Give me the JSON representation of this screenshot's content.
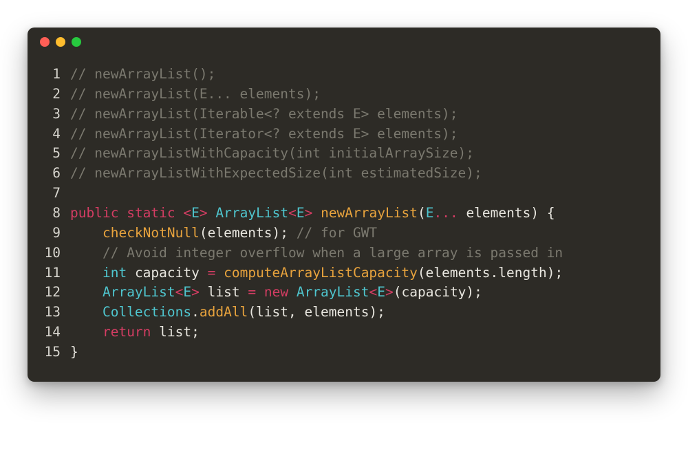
{
  "window": {
    "traffic_lights": {
      "close": "#ff5f56",
      "minimize": "#ffbd2e",
      "maximize": "#27c93f"
    }
  },
  "code": {
    "lines": [
      {
        "num": "1",
        "tokens": [
          {
            "cls": "tok-comment",
            "t": "// newArrayList();"
          }
        ]
      },
      {
        "num": "2",
        "tokens": [
          {
            "cls": "tok-comment",
            "t": "// newArrayList(E... elements);"
          }
        ]
      },
      {
        "num": "3",
        "tokens": [
          {
            "cls": "tok-comment",
            "t": "// newArrayList(Iterable<? extends E> elements);"
          }
        ]
      },
      {
        "num": "4",
        "tokens": [
          {
            "cls": "tok-comment",
            "t": "// newArrayList(Iterator<? extends E> elements);"
          }
        ]
      },
      {
        "num": "5",
        "tokens": [
          {
            "cls": "tok-comment",
            "t": "// newArrayListWithCapacity(int initialArraySize);"
          }
        ]
      },
      {
        "num": "6",
        "tokens": [
          {
            "cls": "tok-comment",
            "t": "// newArrayListWithExpectedSize(int estimatedSize);"
          }
        ]
      },
      {
        "num": "7",
        "tokens": [
          {
            "cls": "tok-ident",
            "t": ""
          }
        ]
      },
      {
        "num": "8",
        "tokens": [
          {
            "cls": "tok-keyword",
            "t": "public"
          },
          {
            "cls": "tok-ident",
            "t": " "
          },
          {
            "cls": "tok-keyword",
            "t": "static"
          },
          {
            "cls": "tok-ident",
            "t": " "
          },
          {
            "cls": "tok-generic",
            "t": "<"
          },
          {
            "cls": "tok-type",
            "t": "E"
          },
          {
            "cls": "tok-generic",
            "t": ">"
          },
          {
            "cls": "tok-ident",
            "t": " "
          },
          {
            "cls": "tok-type",
            "t": "ArrayList"
          },
          {
            "cls": "tok-generic",
            "t": "<"
          },
          {
            "cls": "tok-type",
            "t": "E"
          },
          {
            "cls": "tok-generic",
            "t": ">"
          },
          {
            "cls": "tok-ident",
            "t": " "
          },
          {
            "cls": "tok-func",
            "t": "newArrayList"
          },
          {
            "cls": "tok-punct",
            "t": "("
          },
          {
            "cls": "tok-type",
            "t": "E"
          },
          {
            "cls": "tok-op",
            "t": "..."
          },
          {
            "cls": "tok-ident",
            "t": " elements"
          },
          {
            "cls": "tok-punct",
            "t": ") {"
          }
        ]
      },
      {
        "num": "9",
        "tokens": [
          {
            "cls": "tok-ident",
            "t": "    "
          },
          {
            "cls": "tok-func",
            "t": "checkNotNull"
          },
          {
            "cls": "tok-punct",
            "t": "("
          },
          {
            "cls": "tok-ident",
            "t": "elements"
          },
          {
            "cls": "tok-punct",
            "t": "); "
          },
          {
            "cls": "tok-comment",
            "t": "// for GWT"
          }
        ]
      },
      {
        "num": "10",
        "tokens": [
          {
            "cls": "tok-ident",
            "t": "    "
          },
          {
            "cls": "tok-comment",
            "t": "// Avoid integer overflow when a large array is passed in"
          }
        ]
      },
      {
        "num": "11",
        "tokens": [
          {
            "cls": "tok-ident",
            "t": "    "
          },
          {
            "cls": "tok-type",
            "t": "int"
          },
          {
            "cls": "tok-ident",
            "t": " capacity "
          },
          {
            "cls": "tok-op",
            "t": "="
          },
          {
            "cls": "tok-ident",
            "t": " "
          },
          {
            "cls": "tok-func",
            "t": "computeArrayListCapacity"
          },
          {
            "cls": "tok-punct",
            "t": "("
          },
          {
            "cls": "tok-ident",
            "t": "elements"
          },
          {
            "cls": "tok-punct",
            "t": "."
          },
          {
            "cls": "tok-ident",
            "t": "length"
          },
          {
            "cls": "tok-punct",
            "t": ");"
          }
        ]
      },
      {
        "num": "12",
        "tokens": [
          {
            "cls": "tok-ident",
            "t": "    "
          },
          {
            "cls": "tok-type",
            "t": "ArrayList"
          },
          {
            "cls": "tok-generic",
            "t": "<"
          },
          {
            "cls": "tok-type",
            "t": "E"
          },
          {
            "cls": "tok-generic",
            "t": ">"
          },
          {
            "cls": "tok-ident",
            "t": " list "
          },
          {
            "cls": "tok-op",
            "t": "="
          },
          {
            "cls": "tok-ident",
            "t": " "
          },
          {
            "cls": "tok-keyword",
            "t": "new"
          },
          {
            "cls": "tok-ident",
            "t": " "
          },
          {
            "cls": "tok-type",
            "t": "ArrayList"
          },
          {
            "cls": "tok-generic",
            "t": "<"
          },
          {
            "cls": "tok-type",
            "t": "E"
          },
          {
            "cls": "tok-generic",
            "t": ">"
          },
          {
            "cls": "tok-punct",
            "t": "("
          },
          {
            "cls": "tok-ident",
            "t": "capacity"
          },
          {
            "cls": "tok-punct",
            "t": ");"
          }
        ]
      },
      {
        "num": "13",
        "tokens": [
          {
            "cls": "tok-ident",
            "t": "    "
          },
          {
            "cls": "tok-type",
            "t": "Collections"
          },
          {
            "cls": "tok-punct",
            "t": "."
          },
          {
            "cls": "tok-func",
            "t": "addAll"
          },
          {
            "cls": "tok-punct",
            "t": "("
          },
          {
            "cls": "tok-ident",
            "t": "list"
          },
          {
            "cls": "tok-punct",
            "t": ", "
          },
          {
            "cls": "tok-ident",
            "t": "elements"
          },
          {
            "cls": "tok-punct",
            "t": ");"
          }
        ]
      },
      {
        "num": "14",
        "tokens": [
          {
            "cls": "tok-ident",
            "t": "    "
          },
          {
            "cls": "tok-keyword",
            "t": "return"
          },
          {
            "cls": "tok-ident",
            "t": " list"
          },
          {
            "cls": "tok-punct",
            "t": ";"
          }
        ]
      },
      {
        "num": "15",
        "tokens": [
          {
            "cls": "tok-punct",
            "t": "}"
          }
        ]
      }
    ]
  }
}
